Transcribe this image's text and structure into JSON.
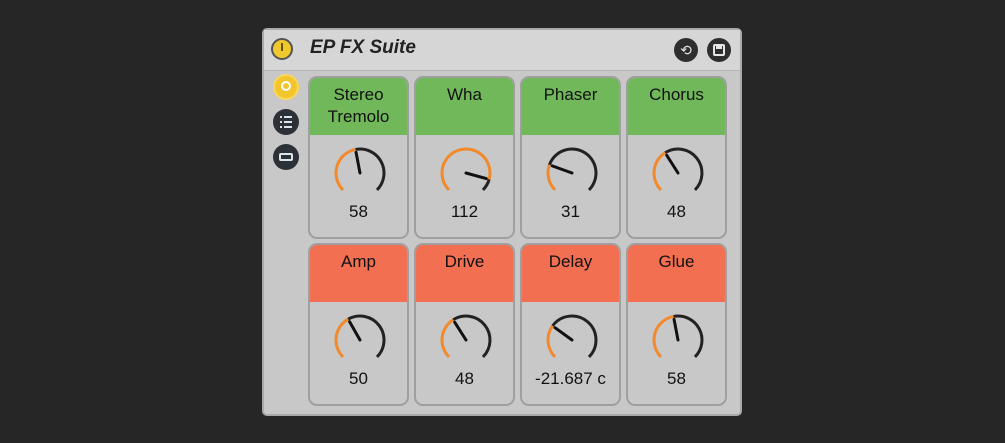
{
  "device": {
    "title": "EP FX Suite",
    "buttons": {
      "power": "power-icon",
      "hot_swap": "hot-swap-icon",
      "save": "save-icon"
    },
    "side_buttons": [
      "macro-icon",
      "chain-list-icon",
      "panel-icon"
    ]
  },
  "cards": [
    {
      "label": "Stereo\nTremolo",
      "value": "58",
      "color": "#71b85a",
      "fraction": 0.46
    },
    {
      "label": "Wha",
      "value": "112",
      "color": "#71b85a",
      "fraction": 0.89
    },
    {
      "label": "Phaser",
      "value": "31",
      "color": "#71b85a",
      "fraction": 0.24
    },
    {
      "label": "Chorus",
      "value": "48",
      "color": "#71b85a",
      "fraction": 0.38
    },
    {
      "label": "Amp",
      "value": "50",
      "color": "#f26f51",
      "fraction": 0.39
    },
    {
      "label": "Drive",
      "value": "48",
      "color": "#f26f51",
      "fraction": 0.38
    },
    {
      "label": "Delay",
      "value": "-21.687 c",
      "color": "#f26f51",
      "fraction": 0.3
    },
    {
      "label": "Glue",
      "value": "58",
      "color": "#f26f51",
      "fraction": 0.46
    }
  ],
  "colors": {
    "knob_arc": "#f2892a",
    "knob_track": "#222222"
  }
}
